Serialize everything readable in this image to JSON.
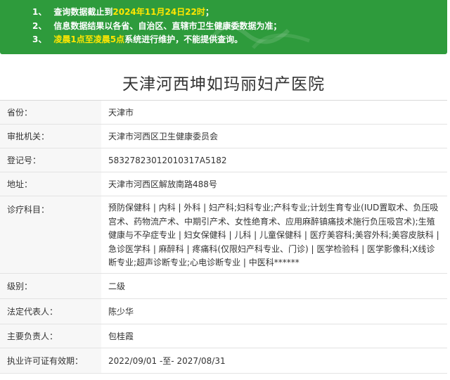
{
  "notice": {
    "items": [
      {
        "num": "1、",
        "text": "查询数据截止到",
        "highlight": "2024年11月24日22时",
        "suffix": "；"
      },
      {
        "num": "2、",
        "text": "信息数据结果以各省、自治区、直辖市卫生健康委数据为准；",
        "highlight": "",
        "suffix": ""
      },
      {
        "num": "3、",
        "text": "",
        "highlight": "凌晨1点至凌晨5点",
        "suffix": "系统进行维护，不能提供查询。"
      }
    ]
  },
  "hospital": {
    "name": "天津河西坤如玛丽妇产医院"
  },
  "info": {
    "rows": [
      {
        "label": "省份：",
        "value": "天津市"
      },
      {
        "label": "审批机关：",
        "value": "天津市河西区卫生健康委员会"
      },
      {
        "label": "登记号：",
        "value": "58327823012010317A5182"
      },
      {
        "label": "地址：",
        "value": "天津市河西区解放南路488号"
      },
      {
        "label": "诊疗科目：",
        "value": "预防保健科 | 内科 | 外科 | 妇产科;妇科专业;产科专业;计划生育专业(IUD置取术、负压吸宫术、药物流产术、中期引产术、女性绝育术、应用麻醉镇痛技术施行负压吸宫术);生殖健康与不孕症专业 | 妇女保健科 | 儿科 | 儿童保健科 | 医疗美容科;美容外科;美容皮肤科 | 急诊医学科 | 麻醉科 | 疼痛科(仅限妇产科专业、门诊) | 医学检验科 | 医学影像科;X线诊断专业;超声诊断专业;心电诊断专业 | 中医科******"
      },
      {
        "label": "级别：",
        "value": "二级"
      },
      {
        "label": "法定代表人：",
        "value": "陈少华"
      },
      {
        "label": "主要负责人：",
        "value": "包桂霞"
      },
      {
        "label": "执业许可证有效期：",
        "value": "2022/09/01 -至- 2027/08/31"
      }
    ]
  }
}
